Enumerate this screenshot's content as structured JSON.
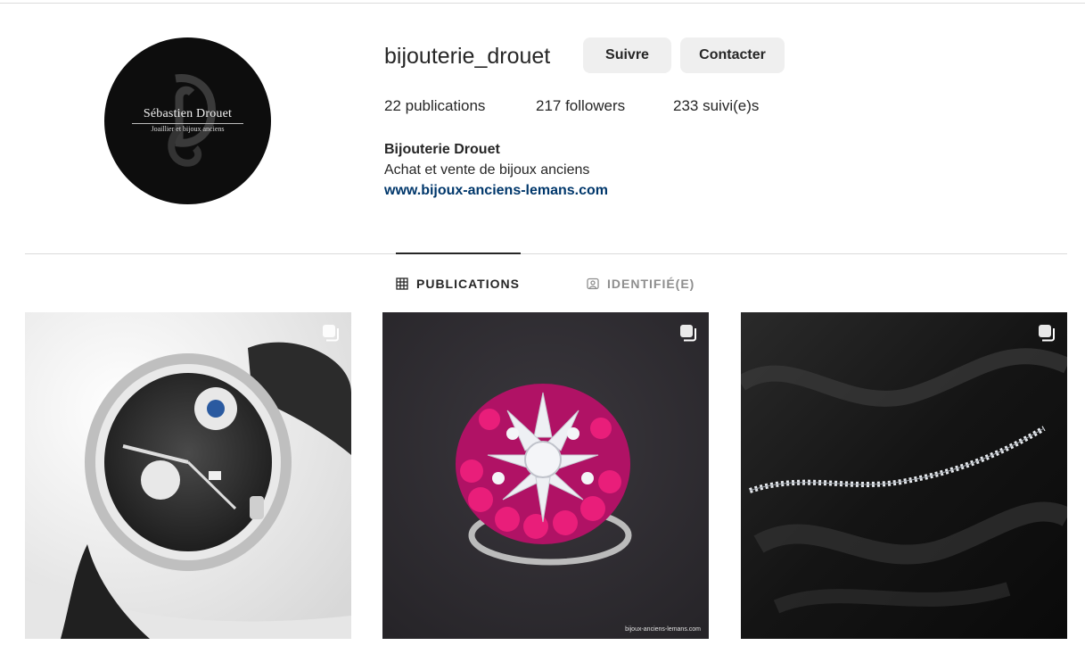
{
  "profile": {
    "username": "bijouterie_drouet",
    "avatar": {
      "brand_name": "Sébastien Drouet",
      "brand_subtitle": "Joaillier et bijoux anciens"
    },
    "buttons": {
      "follow_label": "Suivre",
      "contact_label": "Contacter"
    },
    "stats": {
      "posts": "22 publications",
      "followers": "217 followers",
      "following": "233 suivi(e)s"
    },
    "bio": {
      "full_name": "Bijouterie Drouet",
      "description": "Achat et vente de bijoux anciens",
      "website": "www.bijoux-anciens-lemans.com"
    }
  },
  "tabs": [
    {
      "label": "PUBLICATIONS",
      "icon": "grid-icon",
      "active": true
    },
    {
      "label": "IDENTIFIÉ(E)",
      "icon": "tagged-user-icon",
      "active": false
    }
  ],
  "posts": [
    {
      "subject": "watch",
      "icon": "carousel-icon"
    },
    {
      "subject": "ruby-diamond-ring",
      "icon": "carousel-icon",
      "watermark": "bijoux-anciens-lemans.com"
    },
    {
      "subject": "diamond-bracelet",
      "icon": "carousel-icon"
    }
  ],
  "colors": {
    "text": "#262626",
    "link": "#00376b",
    "button_bg": "#efefef",
    "divider": "#dbdbdb",
    "inactive_tab": "#8e8e8e"
  }
}
